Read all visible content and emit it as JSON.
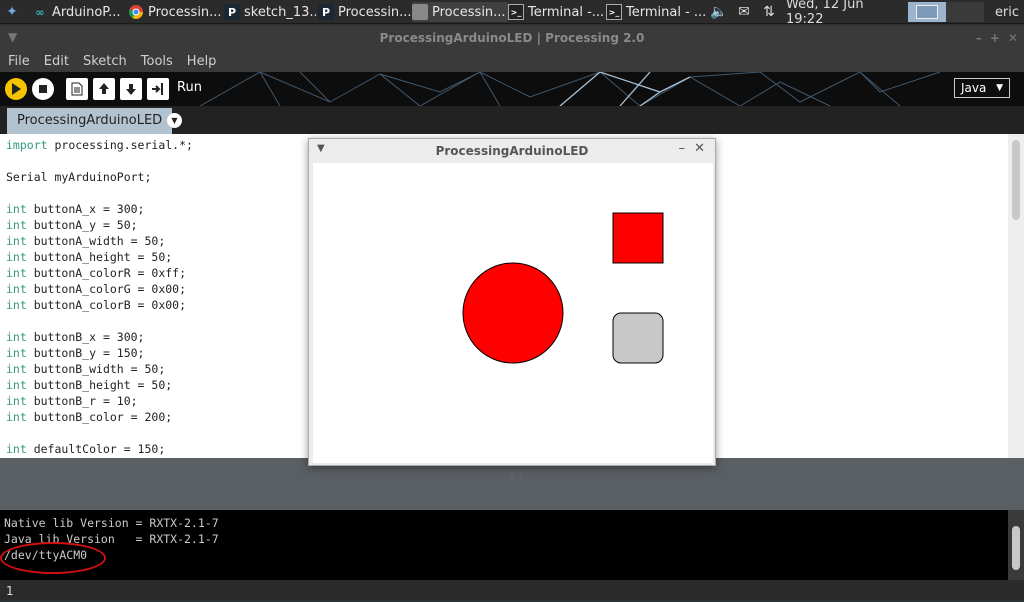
{
  "taskbar": {
    "tasks": [
      {
        "icon": "arduino-icon",
        "label": "ArduinoP..."
      },
      {
        "icon": "chrome-icon",
        "label": "Processin..."
      },
      {
        "icon": "processing-icon",
        "label": "sketch_13..."
      },
      {
        "icon": "processing-icon",
        "label": "Processin..."
      },
      {
        "icon": "window-icon",
        "label": "Processin..."
      },
      {
        "icon": "terminal-icon",
        "label": "Terminal -..."
      },
      {
        "icon": "terminal-icon",
        "label": "Terminal - ..."
      }
    ],
    "clock": "Wed, 12 Jun  19:22",
    "user": "eric"
  },
  "window": {
    "title": "ProcessingArduinoLED | Processing 2.0"
  },
  "menu": [
    "File",
    "Edit",
    "Sketch",
    "Tools",
    "Help"
  ],
  "toolbar": {
    "hover_label": "Run",
    "mode": "Java"
  },
  "tab": {
    "label": "ProcessingArduinoLED"
  },
  "editor": {
    "lines": [
      {
        "kw": "import",
        "text": " processing.serial.*;"
      },
      {
        "kw": "",
        "text": ""
      },
      {
        "kw": "",
        "text": "Serial myArduinoPort;"
      },
      {
        "kw": "",
        "text": ""
      },
      {
        "kw": "int",
        "text": " buttonA_x = 300;"
      },
      {
        "kw": "int",
        "text": " buttonA_y = 50;"
      },
      {
        "kw": "int",
        "text": " buttonA_width = 50;"
      },
      {
        "kw": "int",
        "text": " buttonA_height = 50;"
      },
      {
        "kw": "int",
        "text": " buttonA_colorR = 0xff;"
      },
      {
        "kw": "int",
        "text": " buttonA_colorG = 0x00;"
      },
      {
        "kw": "int",
        "text": " buttonA_colorB = 0x00;"
      },
      {
        "kw": "",
        "text": ""
      },
      {
        "kw": "int",
        "text": " buttonB_x = 300;"
      },
      {
        "kw": "int",
        "text": " buttonB_y = 150;"
      },
      {
        "kw": "int",
        "text": " buttonB_width = 50;"
      },
      {
        "kw": "int",
        "text": " buttonB_height = 50;"
      },
      {
        "kw": "int",
        "text": " buttonB_r = 10;"
      },
      {
        "kw": "int",
        "text": " buttonB_color = 200;"
      },
      {
        "kw": "",
        "text": ""
      },
      {
        "kw": "int",
        "text": " defaultColor = 150;"
      }
    ]
  },
  "console": {
    "lines": [
      "Native lib Version = RXTX-2.1-7",
      "Java lib Version   = RXTX-2.1-7",
      "/dev/ttyACM0"
    ]
  },
  "status": {
    "line": "1"
  },
  "sketch_window": {
    "title": "ProcessingArduinoLED",
    "shapes": {
      "square_color": "#ff0000",
      "circle_color": "#ff0000",
      "rounded_rect_color": "#c8c8c8"
    }
  },
  "colors": {
    "keyword": "#33997e",
    "tab_bg": "#b3c2cf",
    "play_button": "#f5c400",
    "annotation": "#d01010"
  }
}
